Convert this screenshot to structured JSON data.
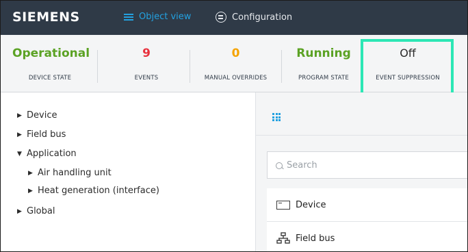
{
  "header": {
    "logo": "SIEMENS",
    "nav": [
      {
        "label": "Object view",
        "active": true
      },
      {
        "label": "Configuration",
        "active": false
      }
    ]
  },
  "status": [
    {
      "value": "Operational",
      "label": "DEVICE STATE",
      "color": "#5ba224"
    },
    {
      "value": "9",
      "label": "EVENTS",
      "color": "#e8313d"
    },
    {
      "value": "0",
      "label": "MANUAL OVERRIDES",
      "color": "#f5a300"
    },
    {
      "value": "Running",
      "label": "PROGRAM STATE",
      "color": "#5ba224"
    },
    {
      "value": "Off",
      "label": "EVENT SUPPRESSION",
      "color": "#2b2b2b"
    }
  ],
  "tree": [
    {
      "label": "Device",
      "expanded": false
    },
    {
      "label": "Field bus",
      "expanded": false
    },
    {
      "label": "Application",
      "expanded": true
    },
    {
      "label": "Air handling unit",
      "expanded": false
    },
    {
      "label": "Heat generation (interface)",
      "expanded": false
    },
    {
      "label": "Global",
      "expanded": false
    }
  ],
  "right_panel": {
    "view_icon": "grid-icon",
    "search_placeholder": "Search",
    "items": [
      {
        "label": "Device",
        "icon": "device-icon"
      },
      {
        "label": "Field bus",
        "icon": "network-icon"
      }
    ]
  },
  "colors": {
    "topbar": "#2f3a47",
    "accent": "#23a1e0",
    "highlight": "#2ce7b5"
  }
}
